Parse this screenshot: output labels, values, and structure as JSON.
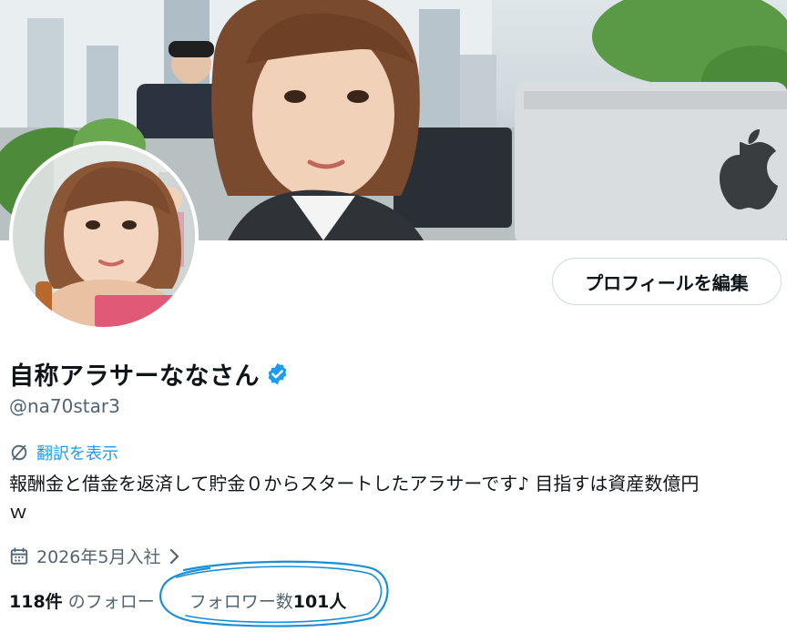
{
  "profile": {
    "display_name": "自称アラサーななさん",
    "handle": "@na70star3",
    "edit_button": "プロフィールを編集",
    "translate_label": "翻訳を表示",
    "bio_line1": "報酬金と借金を返済して貯金０からスタートしたアラサーです♪ 目指すは資産数億円",
    "bio_line2": "ｗ",
    "joined": "2026年5月入社"
  },
  "stats": {
    "following_count": "118件",
    "following_label": " のフォロー",
    "followers_label": "フォロワー数",
    "followers_count": "101人"
  },
  "icons": {
    "verified": "verified-badge-icon",
    "translate": "translate-icon",
    "calendar": "calendar-icon",
    "chevron": "chevron-right-icon"
  },
  "colors": {
    "accent": "#1d9bf0",
    "secondary_text": "#536471",
    "annotation": "#1a8fd8"
  }
}
